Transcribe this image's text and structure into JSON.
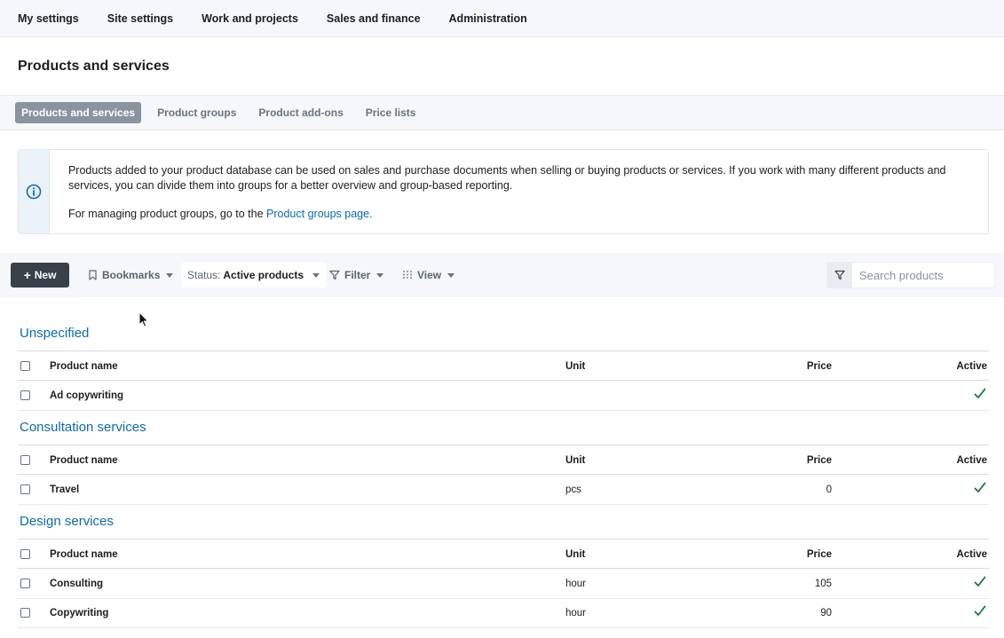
{
  "topnav": [
    "My settings",
    "Site settings",
    "Work and projects",
    "Sales and finance",
    "Administration"
  ],
  "page_title": "Products and services",
  "tabs": [
    {
      "label": "Products and services",
      "active": true
    },
    {
      "label": "Product groups",
      "active": false
    },
    {
      "label": "Product add-ons",
      "active": false
    },
    {
      "label": "Price lists",
      "active": false
    }
  ],
  "info": {
    "icon": "info-icon",
    "paragraph1": "Products added to your product database can be used on sales and purchase documents when selling or buying products or services. If you work with many different products and services, you can divide them into groups for a better overview and group-based reporting.",
    "paragraph2_prefix": "For managing product groups, go to the ",
    "paragraph2_link": "Product groups page",
    "paragraph2_suffix": "."
  },
  "toolbar": {
    "new_label": "New",
    "bookmarks_label": "Bookmarks",
    "status_label": "Status:",
    "status_value": "Active products",
    "filter_label": "Filter",
    "view_label": "View",
    "search_placeholder": "Search products"
  },
  "columns": {
    "name": "Product name",
    "unit": "Unit",
    "price": "Price",
    "active": "Active"
  },
  "groups": [
    {
      "title": "Unspecified",
      "rows": [
        {
          "name": "Ad copywriting",
          "unit": "",
          "price": "",
          "active": true
        }
      ]
    },
    {
      "title": "Consultation services",
      "rows": [
        {
          "name": "Travel",
          "unit": "pcs",
          "price": "0",
          "active": true
        }
      ]
    },
    {
      "title": "Design services",
      "rows": [
        {
          "name": "Consulting",
          "unit": "hour",
          "price": "105",
          "active": true
        },
        {
          "name": "Copywriting",
          "unit": "hour",
          "price": "90",
          "active": true
        }
      ]
    }
  ],
  "colors": {
    "accent": "#0b6bb4",
    "check": "#0f7a3a",
    "new_button": "#3a4049"
  }
}
